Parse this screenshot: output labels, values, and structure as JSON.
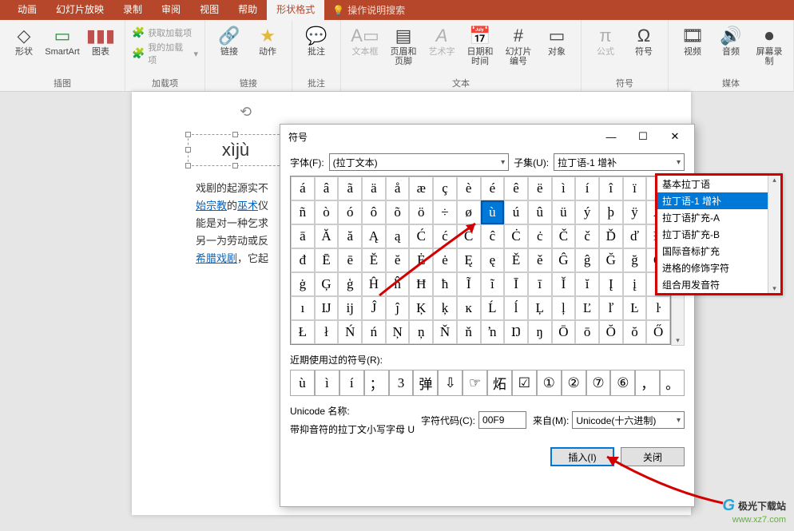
{
  "ribbon": {
    "tabs": [
      "动画",
      "幻灯片放映",
      "录制",
      "审阅",
      "视图",
      "帮助",
      "形状格式"
    ],
    "active_tab": "形状格式",
    "tell_me": "操作说明搜索",
    "groups": {
      "illustrations": {
        "label": "插图",
        "shapes": "形状",
        "smartart": "SmartArt",
        "chart": "图表"
      },
      "addins": {
        "label": "加载项",
        "get": "获取加载项",
        "my": "我的加载项"
      },
      "links": {
        "label": "链接",
        "link": "链接",
        "action": "动作"
      },
      "comments": {
        "label": "批注",
        "comment": "批注"
      },
      "text": {
        "label": "文本",
        "textbox": "文本框",
        "headerfooter": "页眉和页脚",
        "wordart": "艺术字",
        "datetime": "日期和时间",
        "slidenumber": "幻灯片编号",
        "object": "对象"
      },
      "symbols": {
        "label": "符号",
        "equation": "公式",
        "symbol": "符号"
      },
      "media": {
        "label": "媒体",
        "video": "视频",
        "audio": "音频",
        "screen": "屏幕录制"
      }
    }
  },
  "slide": {
    "textbox_value": "xìjù",
    "p1a": "戏剧的起源实不",
    "p2a": "始宗教",
    "p2b": "的",
    "p2c": "巫术",
    "p2d": "仪",
    "p3": "能是对一种乞求",
    "p4": "另一为劳动或反",
    "p5a": "希腊戏剧",
    "p5b": "，它起"
  },
  "dialog": {
    "title": "符号",
    "font_label": "字体(F):",
    "font_value": "(拉丁文本)",
    "subset_label": "子集(U):",
    "subset_value": "拉丁语-1 增补",
    "subset_options": [
      "基本拉丁语",
      "拉丁语-1 增补",
      "拉丁语扩充-A",
      "拉丁语扩充-B",
      "国际音标扩充",
      "进格的修饰字符",
      "组合用发音符"
    ],
    "subset_selected_index": 1,
    "grid": [
      [
        "á",
        "â",
        "ã",
        "ä",
        "å",
        "æ",
        "ç",
        "è",
        "é",
        "ê",
        "ë",
        "ì",
        "í",
        "î",
        "ï",
        "ð"
      ],
      [
        "ñ",
        "ò",
        "ó",
        "ô",
        "õ",
        "ö",
        "÷",
        "ø",
        "ù",
        "ú",
        "û",
        "ü",
        "ý",
        "þ",
        "ÿ",
        "Ā"
      ],
      [
        "ā",
        "Ă",
        "ă",
        "Ą",
        "ą",
        "Ć",
        "ć",
        "Ĉ",
        "ĉ",
        "Ċ",
        "ċ",
        "Č",
        "č",
        "Ď",
        "ď",
        "Đ"
      ],
      [
        "đ",
        "Ē",
        "ē",
        "Ĕ",
        "ĕ",
        "Ė",
        "ė",
        "Ę",
        "ę",
        "Ě",
        "ě",
        "Ĝ",
        "ĝ",
        "Ğ",
        "ğ",
        "Ġ"
      ],
      [
        "ġ",
        "Ģ",
        "ģ",
        "Ĥ",
        "ĥ",
        "Ħ",
        "ħ",
        "Ĩ",
        "ĩ",
        "Ī",
        "ī",
        "Ĭ",
        "ĭ",
        "Į",
        "į",
        "İ"
      ],
      [
        "ı",
        "Ĳ",
        "ĳ",
        "Ĵ",
        "ĵ",
        "Ķ",
        "ķ",
        "ĸ",
        "Ĺ",
        "ĺ",
        "Ļ",
        "ļ",
        "Ľ",
        "ľ",
        "Ŀ",
        "ŀ"
      ],
      [
        "Ł",
        "ł",
        "Ń",
        "ń",
        "Ņ",
        "ņ",
        "Ň",
        "ň",
        "ŉ",
        "Ŋ",
        "ŋ",
        "Ō",
        "ō",
        "Ŏ",
        "ŏ",
        "Ő"
      ]
    ],
    "selected_cell": {
      "row": 1,
      "col": 8
    },
    "recent_label": "近期使用过的符号(R):",
    "recent": [
      "ù",
      "ì",
      "í",
      "；",
      "3",
      "弹",
      "⇩",
      "☞",
      "炻",
      "☑",
      "①",
      "②",
      "⑦",
      "⑥",
      "，",
      "。"
    ],
    "unicode_name_label": "Unicode 名称:",
    "unicode_name": "带抑音符的拉丁文小写字母 U",
    "charcode_label": "字符代码(C):",
    "charcode_value": "00F9",
    "from_label": "来自(M):",
    "from_value": "Unicode(十六进制)",
    "insert_btn": "插入(I)",
    "cancel_btn": "关闭"
  },
  "watermark": {
    "text": "极光下载站",
    "url": "www.xz7.com"
  }
}
